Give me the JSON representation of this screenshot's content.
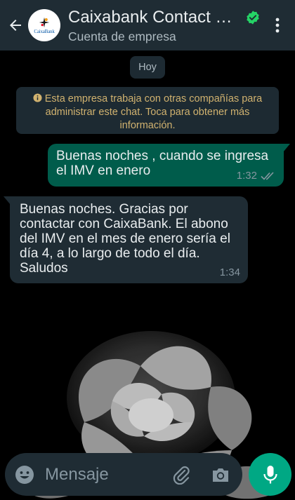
{
  "header": {
    "title": "Caixabank Contact C...",
    "subtitle": "Cuenta de empresa",
    "avatar_logo_text": "CaixaBank"
  },
  "chat": {
    "day_label": "Hoy",
    "system_notice": "Esta empresa trabaja con otras compañías para administrar este chat. Toca para obtener más información.",
    "messages": [
      {
        "direction": "outgoing",
        "text": "Buenas noches , cuando se ingresa el IMV en enero",
        "time": "1:32",
        "status": "read"
      },
      {
        "direction": "incoming",
        "text": "Buenas noches. Gracias por contactar con CaixaBank. El abono del IMV en el mes de enero sería el día 4, a lo largo de todo el día. Saludos",
        "time": "1:34"
      }
    ]
  },
  "composer": {
    "placeholder": "Mensaje"
  },
  "colors": {
    "header_bg": "#1f2c34",
    "outgoing_bubble": "#005c4b",
    "incoming_bubble": "#1f2c34",
    "accent": "#00a884",
    "verified": "#25d366",
    "system_text": "#d1b26f"
  },
  "icons": [
    "back-arrow-icon",
    "verified-icon",
    "more-vert-icon",
    "info-icon",
    "double-check-icon",
    "emoji-icon",
    "attach-icon",
    "camera-icon",
    "mic-icon"
  ]
}
